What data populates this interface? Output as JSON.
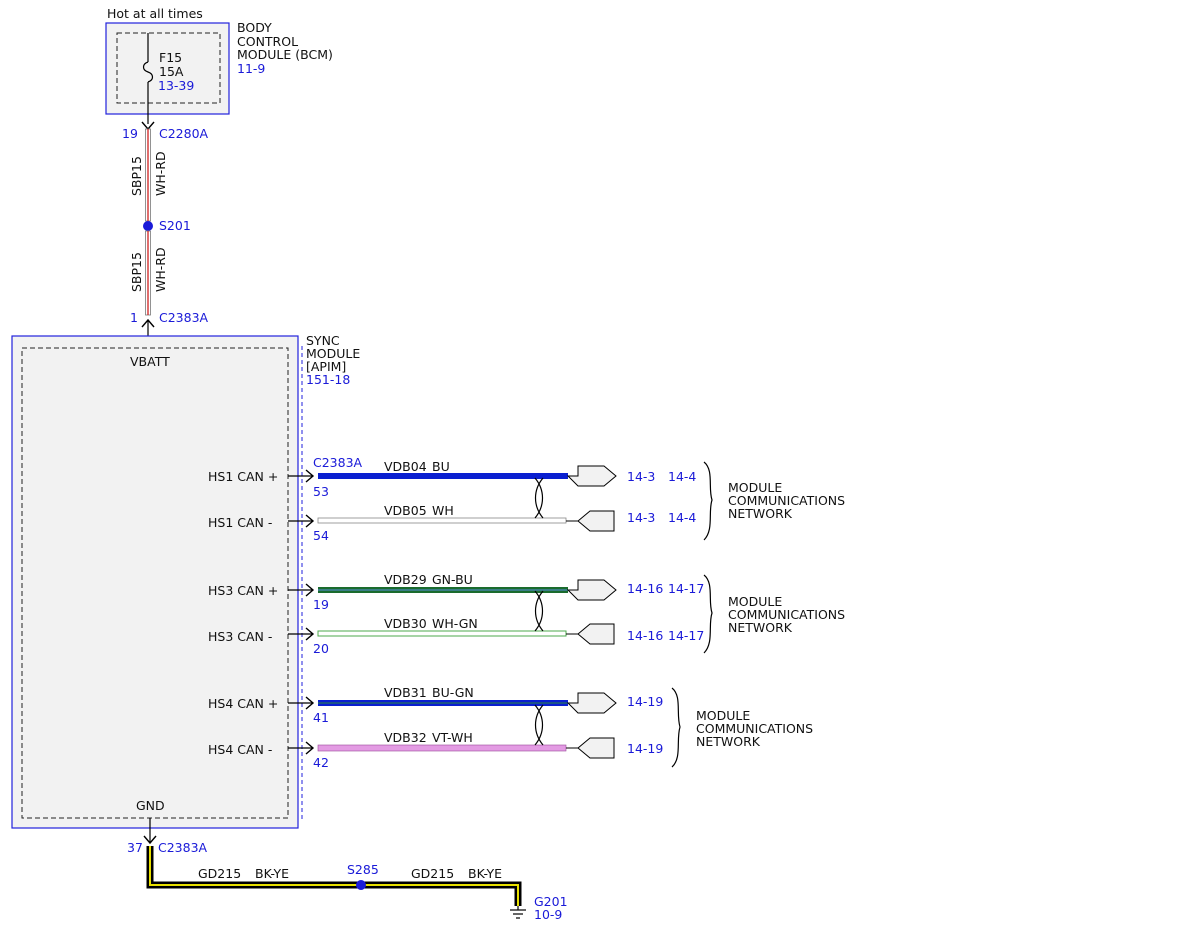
{
  "top": {
    "hot_label": "Hot at all times",
    "bcm": {
      "name_lines": [
        "BODY",
        "CONTROL",
        "MODULE (BCM)"
      ],
      "ref": "11-9",
      "fuse_id": "F15",
      "fuse_rating": "15A",
      "fuse_ref": "13-39"
    },
    "c2280a": {
      "pin": "19",
      "connector": "C2280A"
    },
    "wire1": {
      "circuit": "SBP15",
      "color": "WH-RD"
    },
    "splice": "S201",
    "wire2": {
      "circuit": "SBP15",
      "color": "WH-RD"
    },
    "c2383a_top": {
      "pin": "1",
      "connector": "C2383A"
    }
  },
  "sync": {
    "name_lines": [
      "SYNC",
      "MODULE",
      "[APIM]"
    ],
    "ref": "151-18",
    "vbatt": "VBATT",
    "gnd": "GND",
    "connector": "C2383A"
  },
  "can_pairs": [
    {
      "plus": {
        "label": "HS1 CAN +",
        "pin": "53",
        "circuit": "VDB04",
        "color": "BU",
        "refs": [
          "14-3",
          "14-4"
        ]
      },
      "minus": {
        "label": "HS1 CAN -",
        "pin": "54",
        "circuit": "VDB05",
        "color": "WH",
        "refs": [
          "14-3",
          "14-4"
        ]
      },
      "network": [
        "MODULE",
        "COMMUNICATIONS",
        "NETWORK"
      ]
    },
    {
      "plus": {
        "label": "HS3 CAN +",
        "pin": "19",
        "circuit": "VDB29",
        "color": "GN-BU",
        "refs": [
          "14-16",
          "14-17"
        ]
      },
      "minus": {
        "label": "HS3 CAN -",
        "pin": "20",
        "circuit": "VDB30",
        "color": "WH-GN",
        "refs": [
          "14-16",
          "14-17"
        ]
      },
      "network": [
        "MODULE",
        "COMMUNICATIONS",
        "NETWORK"
      ]
    },
    {
      "plus": {
        "label": "HS4 CAN +",
        "pin": "41",
        "circuit": "VDB31",
        "color": "BU-GN",
        "refs": [
          "14-19"
        ]
      },
      "minus": {
        "label": "HS4 CAN -",
        "pin": "42",
        "circuit": "VDB32",
        "color": "VT-WH",
        "refs": [
          "14-19"
        ]
      },
      "network": [
        "MODULE",
        "COMMUNICATIONS",
        "NETWORK"
      ]
    }
  ],
  "ground": {
    "pin": "37",
    "connector": "C2383A",
    "left_circuit": "GD215",
    "left_color": "BK-YE",
    "splice": "S285",
    "right_circuit": "GD215",
    "right_color": "BK-YE",
    "ground_id": "G201",
    "ground_ref": "10-9"
  },
  "colors": {
    "module_border": "#2222dd",
    "reference_text": "#1a1ad8",
    "blue_wire": "#0a1fd0",
    "green_wire": "#1a6b2e",
    "violet_wire": "#e39be3",
    "white_wire_outline": "#888888",
    "yellow_stripe": "#e8e000"
  }
}
